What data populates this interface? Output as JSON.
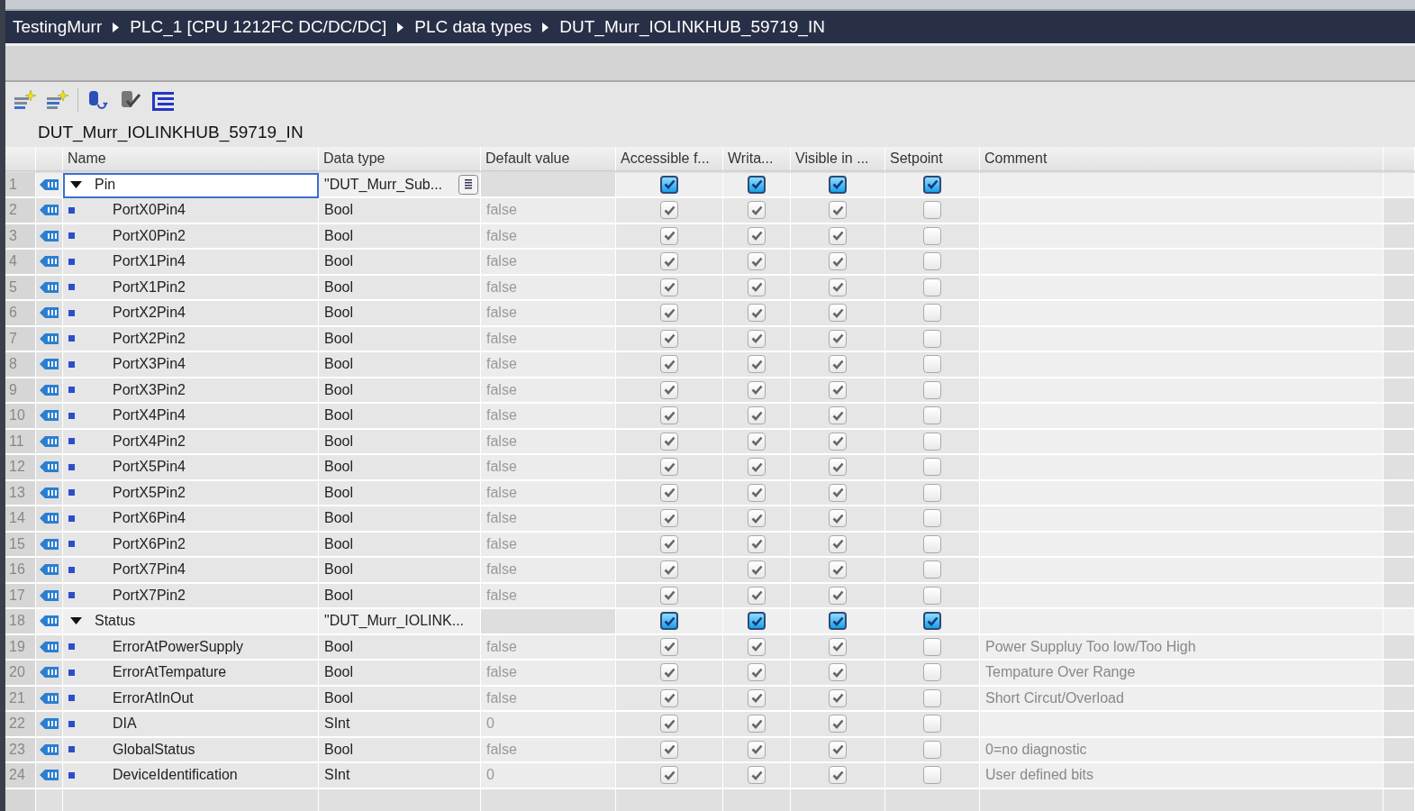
{
  "breadcrumb": [
    "TestingMurr",
    "PLC_1 [CPU 1212FC DC/DC/DC]",
    "PLC data types",
    "DUT_Murr_IOLINKHUB_59719_IN"
  ],
  "title": "DUT_Murr_IOLINKHUB_59719_IN",
  "table": {
    "columns": [
      "Name",
      "Data type",
      "Default value",
      "Accessible f...",
      "Writa...",
      "Visible in ...",
      "Setpoint",
      "Comment"
    ],
    "rows": [
      {
        "number": "1",
        "name": "Pin",
        "data_type": "\"DUT_Murr_Sub...",
        "selected": true,
        "expanded": true,
        "disabled": false,
        "checks": [
          true,
          true,
          true,
          true
        ],
        "children": [
          {
            "number": "2",
            "name": "PortX0Pin4",
            "data_type": "Bool",
            "default_value": "false",
            "selected": false,
            "disabled": true,
            "checks": [
              true,
              true,
              true,
              false
            ]
          },
          {
            "number": "3",
            "name": "PortX0Pin2",
            "data_type": "Bool",
            "default_value": "false",
            "selected": false,
            "disabled": true,
            "checks": [
              true,
              true,
              true,
              false
            ]
          },
          {
            "number": "4",
            "name": "PortX1Pin4",
            "data_type": "Bool",
            "default_value": "false",
            "selected": false,
            "disabled": true,
            "checks": [
              true,
              true,
              true,
              false
            ]
          },
          {
            "number": "5",
            "name": "PortX1Pin2",
            "data_type": "Bool",
            "default_value": "false",
            "selected": false,
            "disabled": true,
            "checks": [
              true,
              true,
              true,
              false
            ]
          },
          {
            "number": "6",
            "name": "PortX2Pin4",
            "data_type": "Bool",
            "default_value": "false",
            "selected": false,
            "disabled": true,
            "checks": [
              true,
              true,
              true,
              false
            ]
          },
          {
            "number": "7",
            "name": "PortX2Pin2",
            "data_type": "Bool",
            "default_value": "false",
            "selected": false,
            "disabled": true,
            "checks": [
              true,
              true,
              true,
              false
            ]
          },
          {
            "number": "8",
            "name": "PortX3Pin4",
            "data_type": "Bool",
            "default_value": "false",
            "selected": false,
            "disabled": true,
            "checks": [
              true,
              true,
              true,
              false
            ]
          },
          {
            "number": "9",
            "name": "PortX3Pin2",
            "data_type": "Bool",
            "default_value": "false",
            "selected": false,
            "disabled": true,
            "checks": [
              true,
              true,
              true,
              false
            ]
          },
          {
            "number": "10",
            "name": "PortX4Pin4",
            "data_type": "Bool",
            "default_value": "false",
            "selected": false,
            "disabled": true,
            "checks": [
              true,
              true,
              true,
              false
            ]
          },
          {
            "number": "11",
            "name": "PortX4Pin2",
            "data_type": "Bool",
            "default_value": "false",
            "selected": false,
            "disabled": true,
            "checks": [
              true,
              true,
              true,
              false
            ]
          },
          {
            "number": "12",
            "name": "PortX5Pin4",
            "data_type": "Bool",
            "default_value": "false",
            "selected": false,
            "disabled": true,
            "checks": [
              true,
              true,
              true,
              false
            ]
          },
          {
            "number": "13",
            "name": "PortX5Pin2",
            "data_type": "Bool",
            "default_value": "false",
            "selected": false,
            "disabled": true,
            "checks": [
              true,
              true,
              true,
              false
            ]
          },
          {
            "number": "14",
            "name": "PortX6Pin4",
            "data_type": "Bool",
            "default_value": "false",
            "selected": false,
            "disabled": true,
            "checks": [
              true,
              true,
              true,
              false
            ]
          },
          {
            "number": "15",
            "name": "PortX6Pin2",
            "data_type": "Bool",
            "default_value": "false",
            "selected": false,
            "disabled": true,
            "checks": [
              true,
              true,
              true,
              false
            ]
          },
          {
            "number": "16",
            "name": "PortX7Pin4",
            "data_type": "Bool",
            "default_value": "false",
            "selected": false,
            "disabled": true,
            "checks": [
              true,
              true,
              true,
              false
            ]
          },
          {
            "number": "17",
            "name": "PortX7Pin2",
            "data_type": "Bool",
            "default_value": "false",
            "selected": false,
            "disabled": true,
            "checks": [
              true,
              true,
              true,
              false
            ]
          }
        ]
      },
      {
        "number": "18",
        "name": "Status",
        "data_type": "\"DUT_Murr_IOLINK...",
        "selected": false,
        "expanded": true,
        "disabled": false,
        "checks": [
          true,
          true,
          true,
          true
        ],
        "children": [
          {
            "number": "19",
            "name": "ErrorAtPowerSupply",
            "data_type": "Bool",
            "default_value": "false",
            "selected": false,
            "disabled": true,
            "checks": [
              true,
              true,
              true,
              false
            ],
            "comment": "Power Suppluy Too low/Too High"
          },
          {
            "number": "20",
            "name": "ErrorAtTempature",
            "data_type": "Bool",
            "default_value": "false",
            "selected": false,
            "disabled": true,
            "checks": [
              true,
              true,
              true,
              false
            ],
            "comment": "Tempature Over Range"
          },
          {
            "number": "21",
            "name": "ErrorAtInOut",
            "data_type": "Bool",
            "default_value": "false",
            "selected": false,
            "disabled": true,
            "checks": [
              true,
              true,
              true,
              false
            ],
            "comment": "Short Circut/Overload"
          },
          {
            "number": "22",
            "name": "DIA",
            "data_type": "SInt",
            "default_value": "0",
            "selected": false,
            "disabled": true,
            "checks": [
              true,
              true,
              true,
              false
            ]
          },
          {
            "number": "23",
            "name": "GlobalStatus",
            "data_type": "Bool",
            "default_value": "false",
            "selected": false,
            "disabled": true,
            "checks": [
              true,
              true,
              true,
              false
            ],
            "comment": "0=no diagnostic"
          },
          {
            "number": "24",
            "name": "DeviceIdentification",
            "data_type": "SInt",
            "default_value": "0",
            "selected": false,
            "disabled": true,
            "checks": [
              true,
              true,
              true,
              false
            ],
            "comment": "User defined bits"
          }
        ]
      }
    ]
  }
}
